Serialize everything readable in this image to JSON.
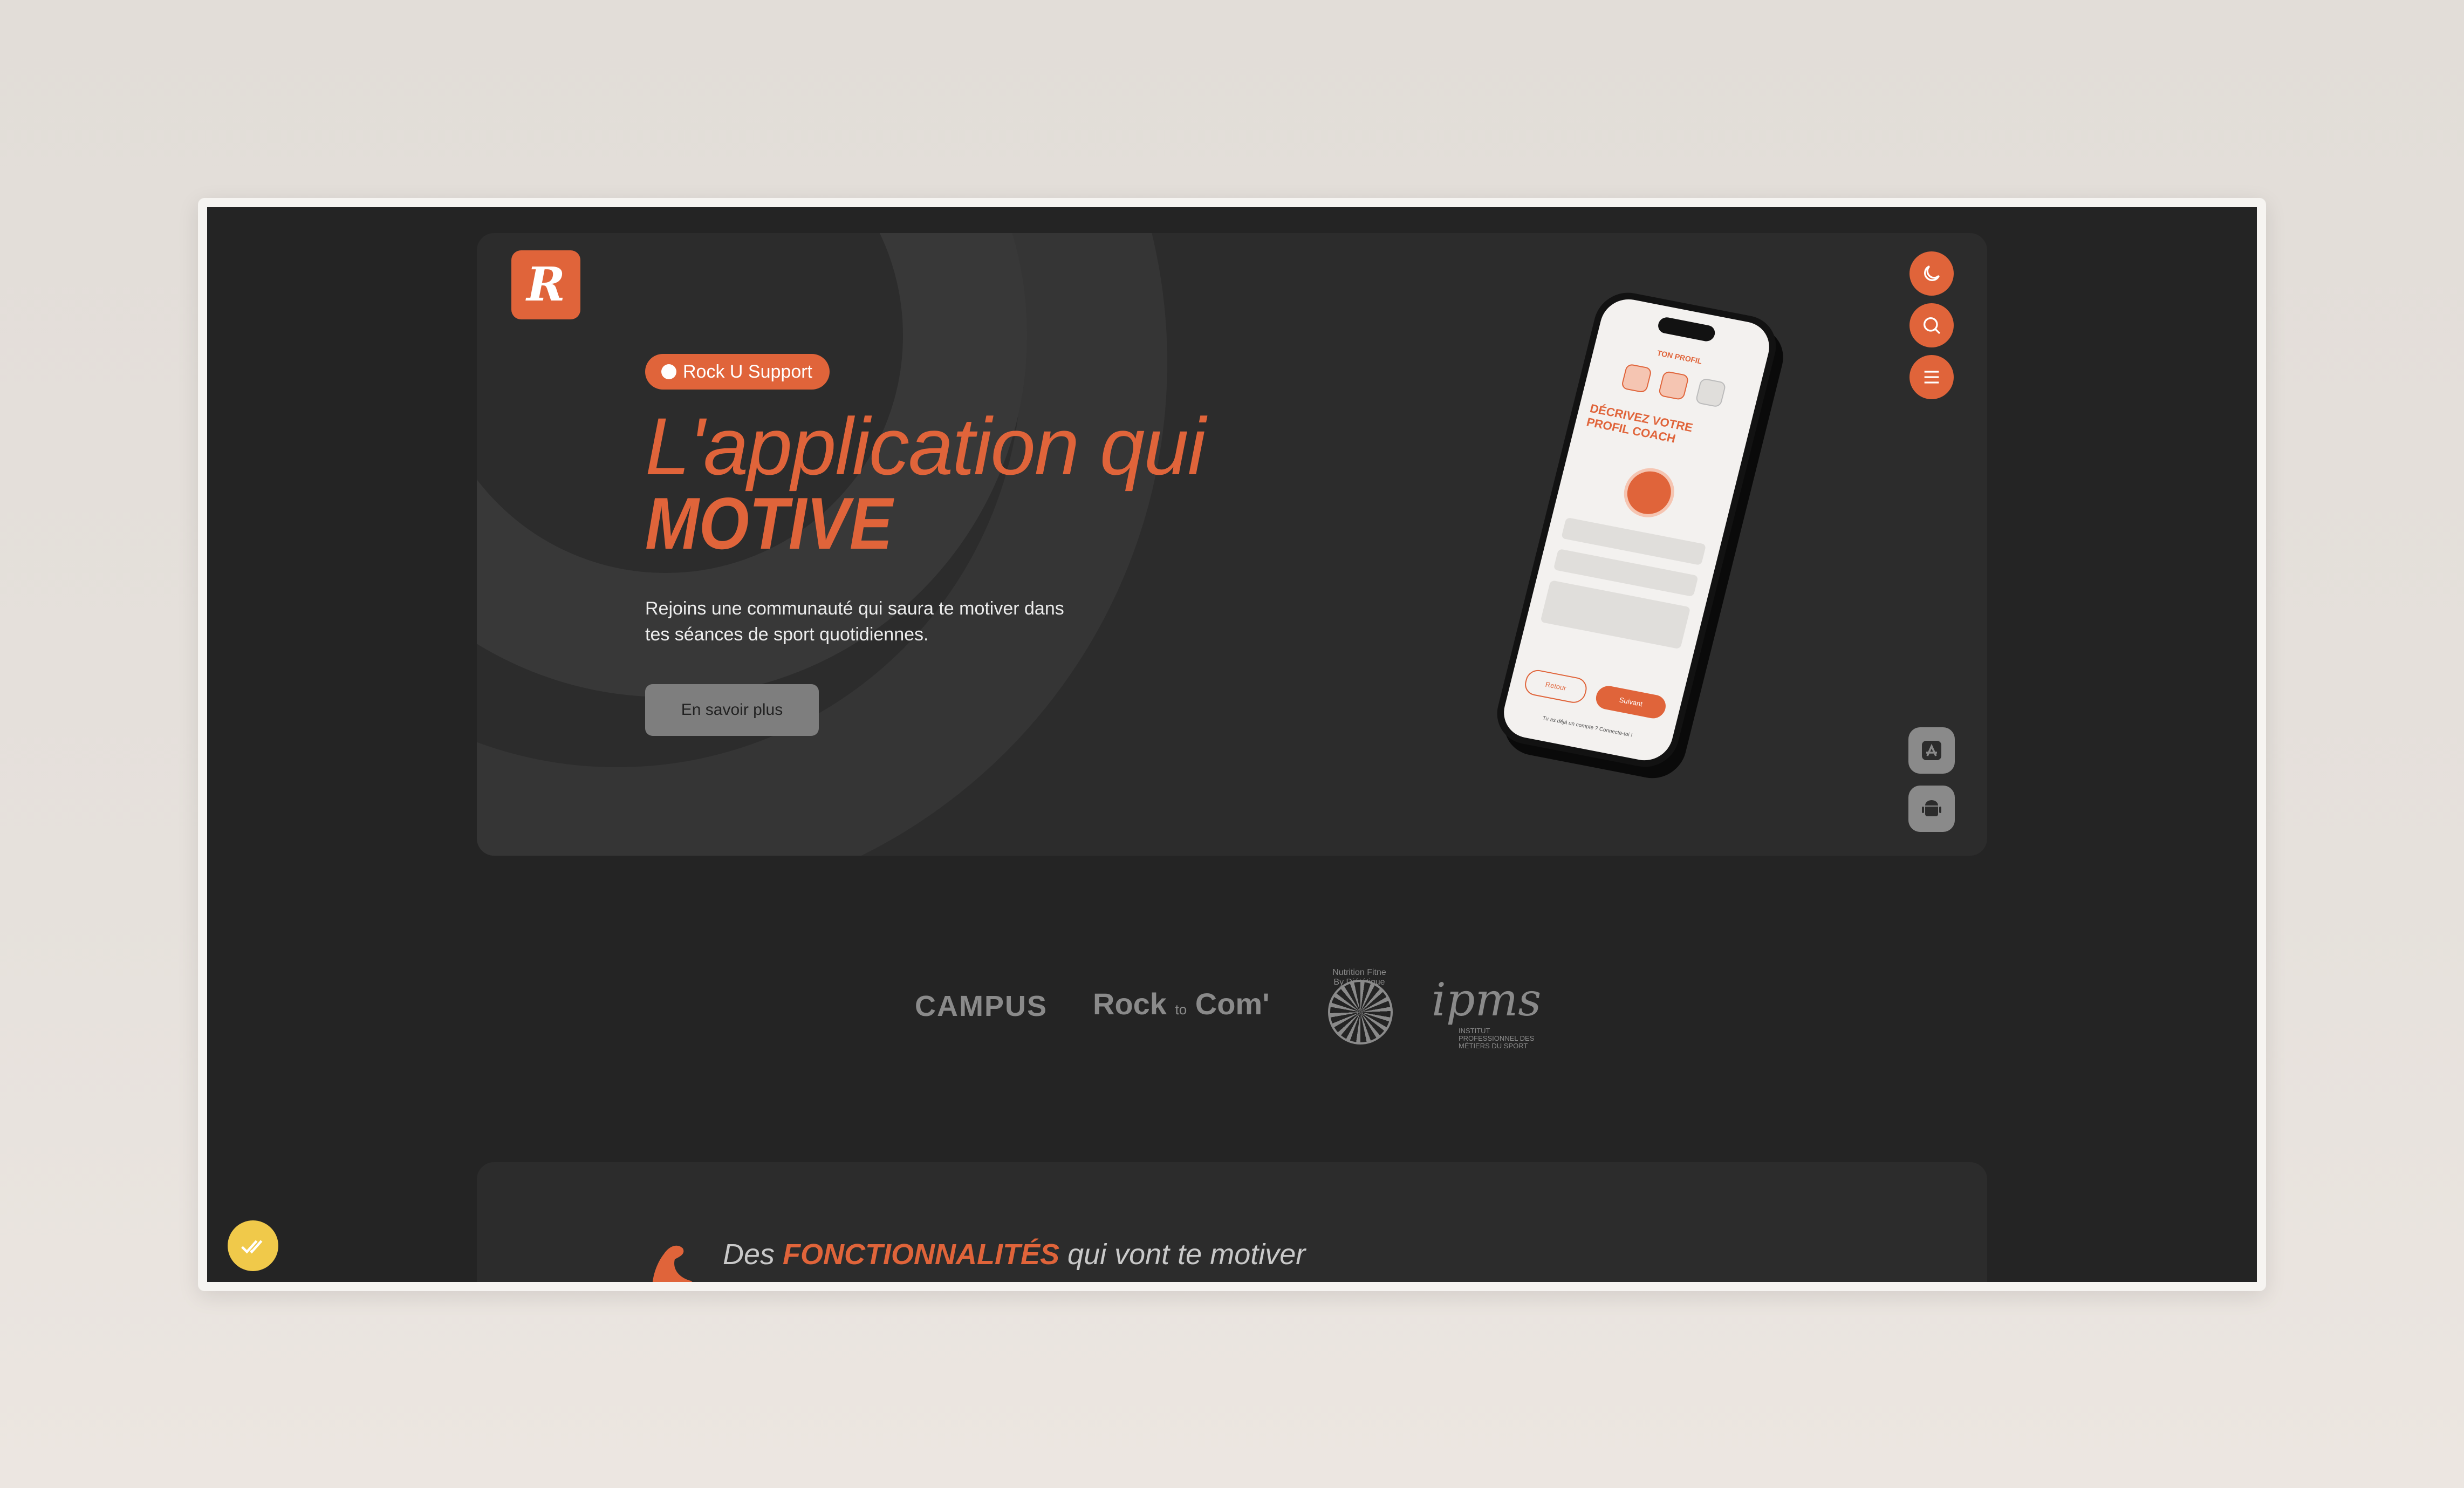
{
  "hero": {
    "logo_letter": "R",
    "badge": "Rock U Support",
    "title_line1": "L'application qui",
    "title_line2": "MOTIVE",
    "description": "Rejoins une communauté qui saura te motiver dans tes séances de sport quotidiennes.",
    "cta_label": "En savoir plus"
  },
  "side_controls": [
    "moon-icon",
    "search-icon",
    "menu-icon"
  ],
  "store_buttons": [
    "app-store-icon",
    "android-icon"
  ],
  "phone_screen": {
    "header": "TON PROFIL",
    "heading": "DÉCRIVEZ VOTRE PROFIL COACH",
    "back_button": "Retour",
    "next_button": "Suivant",
    "footer": "Tu as déjà un compte ? Connecte-toi !"
  },
  "partners": {
    "campus": "CAMPUS",
    "rock_main": "Rock",
    "rock_small": "to",
    "rock_end": "Com'",
    "nfdi_label": "Nutrition Fitne By Diététique",
    "ipms": "ipms",
    "ipms_sub": "INSTITUT PROFESSIONNEL DES MÉTIERS DU SPORT"
  },
  "features": {
    "title_pre": "Des",
    "title_highlight": "FONCTIONNALITÉS",
    "title_post": "qui vont te motiver"
  },
  "colors": {
    "accent": "#e0643a",
    "background": "#242424",
    "card": "#2c2c2c",
    "fab": "#f0c94a"
  }
}
